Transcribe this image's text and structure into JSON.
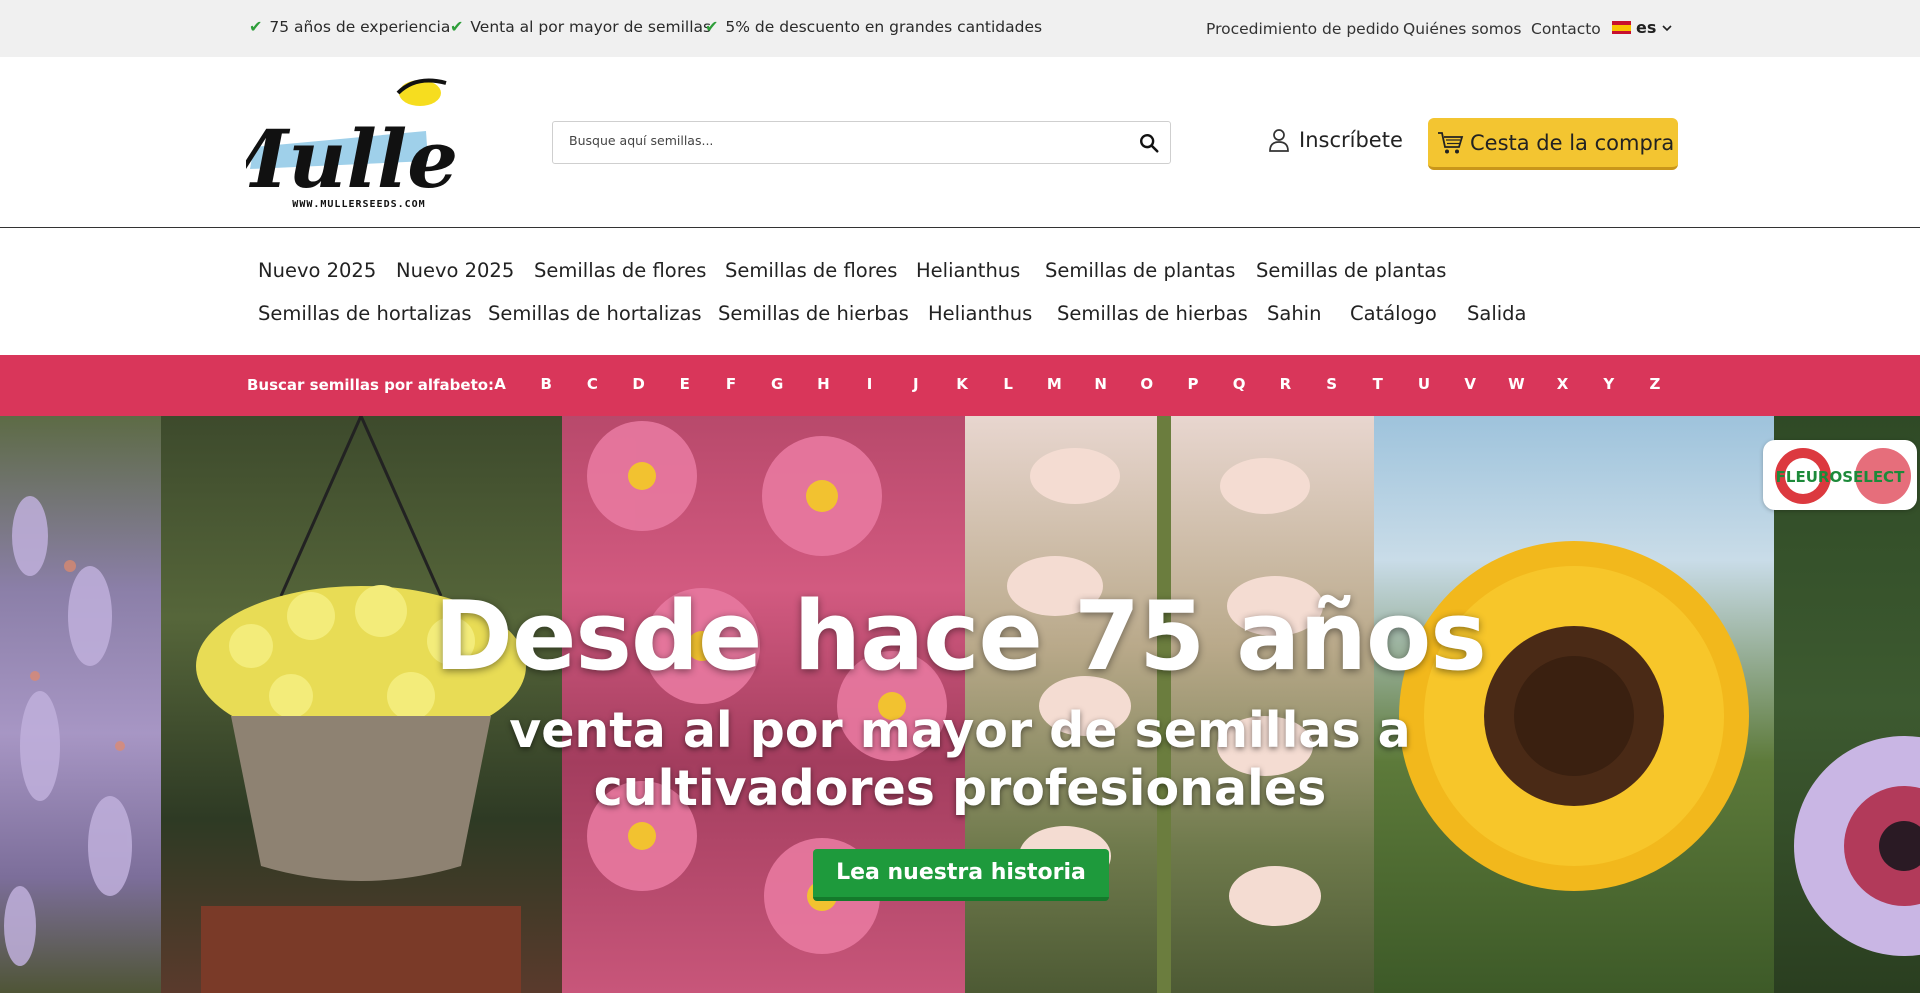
{
  "topbar": {
    "usps": [
      "75 años de experiencia",
      "Venta al por mayor de semillas",
      "5% de descuento en grandes cantidades"
    ],
    "links": [
      "Procedimiento de pedido",
      "Quiénes somos",
      "Contacto"
    ],
    "language": "es"
  },
  "header": {
    "logo_text": "Muller",
    "logo_url_text": "WWW.MULLERSEEDS.COM",
    "search_placeholder": "Busque aquí semillas...",
    "signup_label": "Inscríbete",
    "cart_label": "Cesta de la compra"
  },
  "nav": {
    "row1": [
      "Nuevo 2025",
      "Nuevo 2025",
      "Semillas de flores",
      "Semillas de flores",
      "Helianthus",
      "Semillas de plantas",
      "Semillas de plantas"
    ],
    "row2": [
      "Semillas de hortalizas",
      "Semillas de hortalizas",
      "Semillas de hierbas",
      "Helianthus",
      "Semillas de hierbas",
      "Sahin",
      "Catálogo",
      "Salida"
    ]
  },
  "alphabet": {
    "label": "Buscar semillas por alfabeto:",
    "letters": [
      "A",
      "B",
      "C",
      "D",
      "E",
      "F",
      "G",
      "H",
      "I",
      "J",
      "K",
      "L",
      "M",
      "N",
      "O",
      "P",
      "Q",
      "R",
      "S",
      "T",
      "U",
      "V",
      "W",
      "X",
      "Y",
      "Z"
    ]
  },
  "hero": {
    "title": "Desde hace 75 años",
    "subtitle_line1": "venta al por mayor de semillas a",
    "subtitle_line2": "cultivadores profesionales",
    "button_label": "Lea nuestra historia",
    "badge_text": "FLEUROSELECT"
  },
  "colors": {
    "alphabet_bar": "#d9365a",
    "cart_button": "#f3c531",
    "hero_button": "#1e9a3c",
    "check": "#2e9e3a"
  }
}
